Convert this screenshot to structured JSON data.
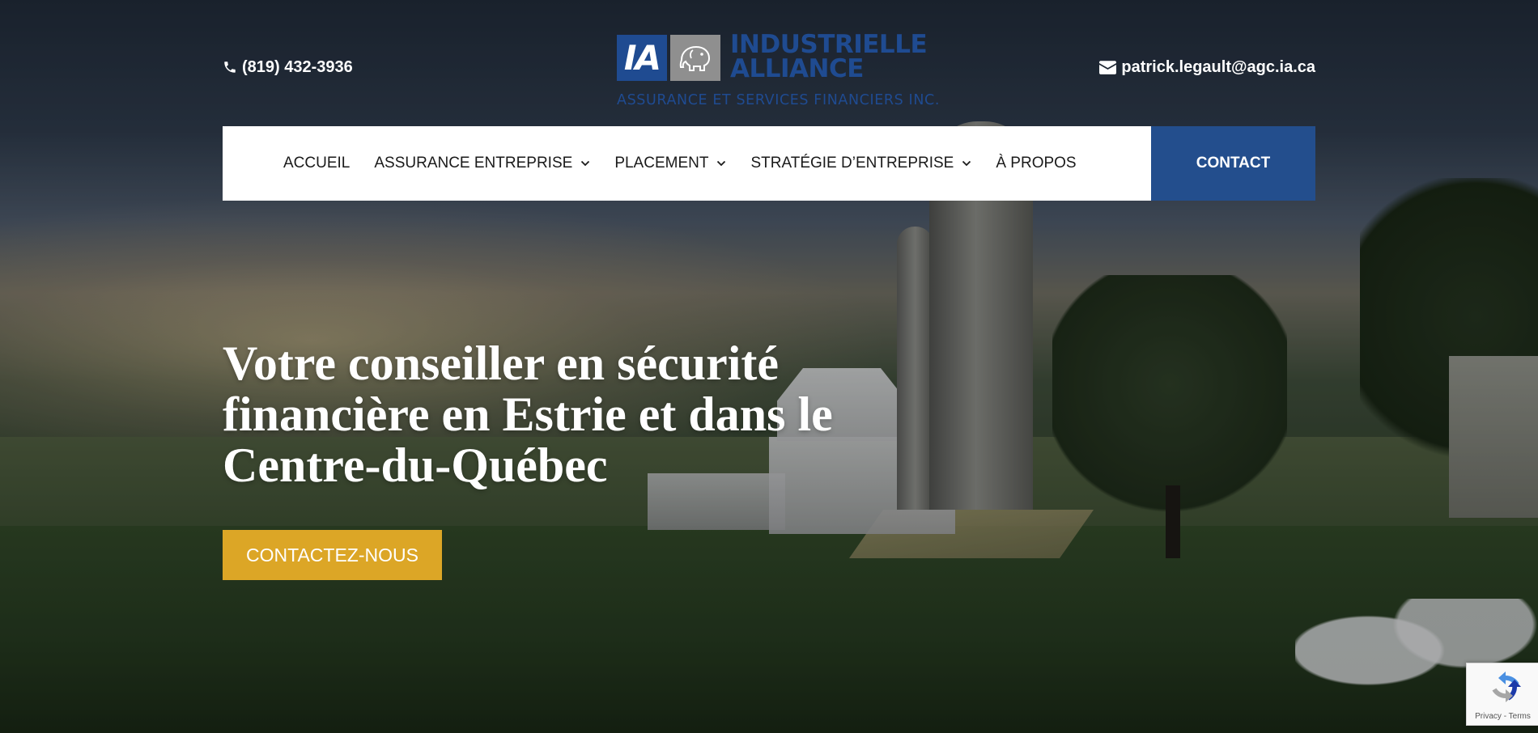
{
  "header": {
    "phone": "(819) 432-3936",
    "email": "patrick.legault@agc.ia.ca",
    "logo": {
      "mark_text": "IA",
      "name_line1": "INDUSTRIELLE",
      "name_line2": "ALLIANCE",
      "tagline": "ASSURANCE ET SERVICES FINANCIERS INC."
    },
    "icons": {
      "phone": "phone-icon",
      "email": "envelope-icon",
      "logo_animal": "elephant-icon"
    }
  },
  "nav": {
    "items": [
      {
        "label": "ACCUEIL",
        "dropdown": false
      },
      {
        "label": "ASSURANCE ENTREPRISE",
        "dropdown": true
      },
      {
        "label": "PLACEMENT",
        "dropdown": true
      },
      {
        "label": "STRATÉGIE D’ENTREPRISE",
        "dropdown": true
      },
      {
        "label": "À PROPOS",
        "dropdown": false
      }
    ],
    "contact_label": "CONTACT"
  },
  "hero": {
    "title_line1": "Votre conseiller en sécurité",
    "title_line2": "financière en Estrie et dans le",
    "title_line3": "Centre-du-Québec",
    "cta_label": "CONTACTEZ-NOUS"
  },
  "recaptcha": {
    "privacy": "Privacy",
    "separator": " - ",
    "terms": "Terms"
  },
  "colors": {
    "brand_blue": "#234e8d",
    "logo_blue": "#1f4b91",
    "cta_gold": "#dca626",
    "nav_bg": "#ffffff"
  }
}
